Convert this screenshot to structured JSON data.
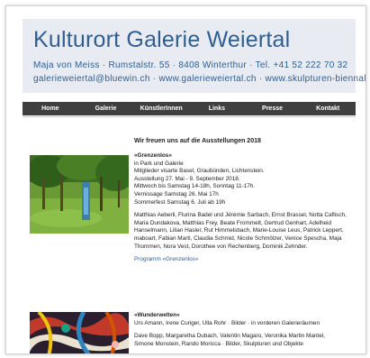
{
  "header": {
    "title": "Kulturort Galerie Weiertal",
    "line1": "Maja von Meiss · Rumstalstr. 55 · 8408 Winterthur · Tel. +41 52 222 70 32",
    "line2": "galerieweiertal@bluewin.ch · www.galerieweiertal.ch · www.skulpturen-biennale.ch"
  },
  "nav": [
    "Home",
    "Galerie",
    "KünstlerInnen",
    "Links",
    "Presse",
    "Kontakt"
  ],
  "main": {
    "heading": "Wir freuen uns auf die Ausstellungen 2018",
    "exhibition1": {
      "title": "«Grenzenlos»",
      "lines": [
        "in Park und Galerie",
        "Mitglieder visarte Basel, Graubünden, Lichtenstein.",
        "Ausstellung 27. Mai - 9. September 2018.",
        "Mittwoch bis Samstag 14-18h, Sonntag 11-17h.",
        "Vernissage Samstag 26. Mai 17h",
        "Sommerfest Samstag 6. Juli ab 19h"
      ],
      "artists_lines": [
        "Matthias Aeberli, Flurina Badel und Jérémie Sarbach, Ernst Brassel, Notta Caflisch,",
        "Maria Dundakova, Matthias Frey, Beate Frommelt, Gertrud Genhart, Adelheid",
        "Hanselmann, Lilian Hasler, Rut Himmelsbach, Marie-Louise Leus, Patrick Leppert,",
        "maboart, Fabian Marti, Claudia Schmid, Nicole Schmölzer, Venice Spescha, Maja",
        "Thommen, Nora Vest, Dorothee von Rechenberg, Dominik Zehnder."
      ],
      "program_link": "Programm «Grenzenlos»"
    },
    "exhibition2": {
      "title": "«Wunderwelten»",
      "line1": "Urs Amann, Irene Curiger, Ulla Rohr · Bilder · in vorderen Galerieräumen",
      "lines2": [
        "Dave Bopp, Margaretha Dubach, Valentin Magaro, Veronika Martin Mantel,",
        "Simone Monstein, Rando Moricca · Bilder, Skulpturen und Objekte"
      ]
    }
  }
}
